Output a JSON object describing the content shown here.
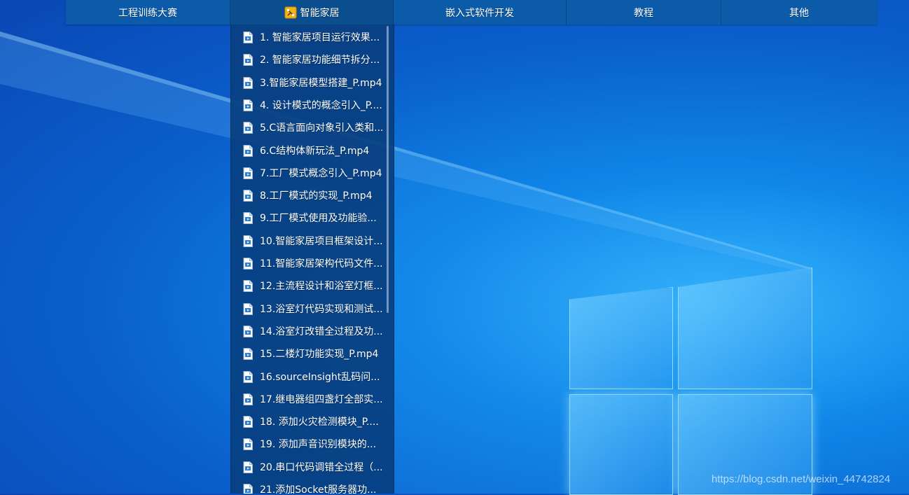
{
  "toolbar": {
    "buttons": [
      {
        "label": "工程训练大赛"
      },
      {
        "label": "智能家居",
        "icon": "folder-icon"
      },
      {
        "label": "嵌入式软件开发"
      },
      {
        "label": "教程"
      },
      {
        "label": "其他"
      }
    ]
  },
  "dropdown": {
    "items": [
      {
        "label": "1. 智能家居项目运行效果..."
      },
      {
        "label": "2. 智能家居功能细节拆分..."
      },
      {
        "label": "3.智能家居模型搭建_P.mp4"
      },
      {
        "label": "4. 设计模式的概念引入_P...."
      },
      {
        "label": "5.C语言面向对象引入类和..."
      },
      {
        "label": "6.C结构体新玩法_P.mp4"
      },
      {
        "label": "7.工厂模式概念引入_P.mp4"
      },
      {
        "label": "8.工厂模式的实现_P.mp4"
      },
      {
        "label": "9.工厂模式使用及功能验..."
      },
      {
        "label": "10.智能家居项目框架设计..."
      },
      {
        "label": "11.智能家居架构代码文件..."
      },
      {
        "label": "12.主流程设计和浴室灯框..."
      },
      {
        "label": "13.浴室灯代码实现和测试..."
      },
      {
        "label": "14.浴室灯改错全过程及功..."
      },
      {
        "label": "15.二楼灯功能实现_P.mp4"
      },
      {
        "label": "16.sourceInsight乱码问..."
      },
      {
        "label": "17.继电器组四盏灯全部实..."
      },
      {
        "label": "18. 添加火灾检测模块_P...."
      },
      {
        "label": "19. 添加声音识别模块的..."
      },
      {
        "label": "20.串口代码调错全过程（..."
      },
      {
        "label": "21.添加Socket服务器功..."
      }
    ],
    "item_icon": "video-file-icon"
  },
  "watermark": "https://blog.csdn.net/weixin_44742824",
  "colors": {
    "toolbar_bg": "#0c5ba9",
    "dropdown_bg": "#094080",
    "desktop_blue": "#0a5fcc"
  }
}
